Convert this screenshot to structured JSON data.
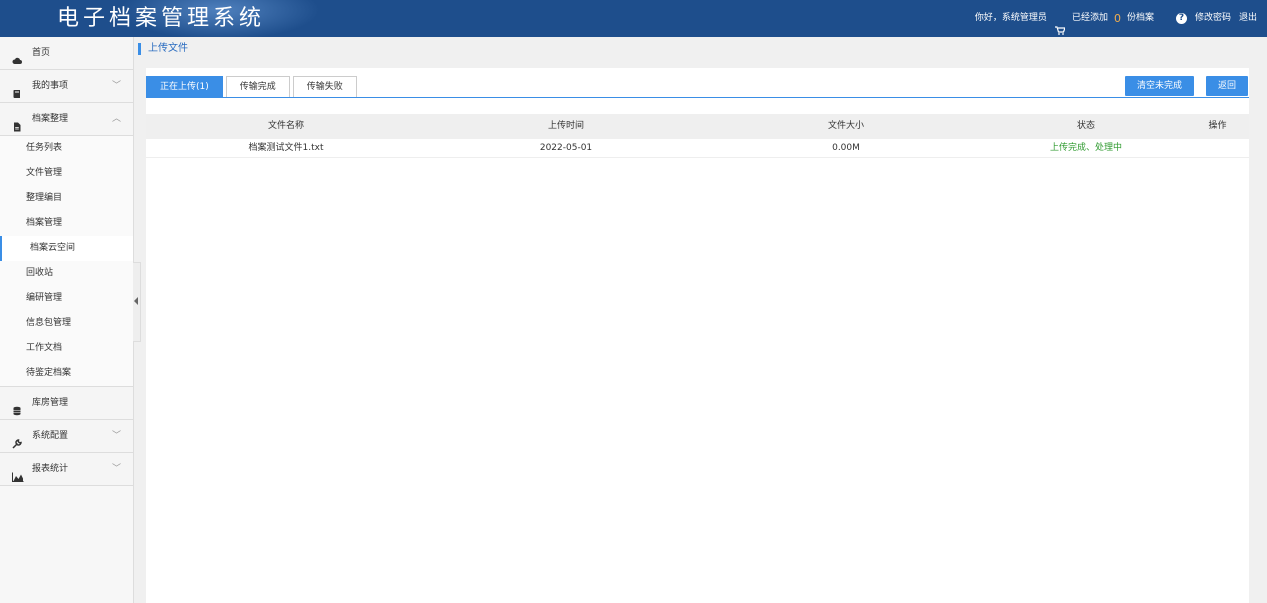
{
  "header": {
    "title": "电子档案管理系统",
    "greeting": "你好，系统管理员",
    "added_prefix": "已经添加",
    "added_count": "0",
    "added_suffix": "份档案",
    "change_password": "修改密码",
    "logout": "退出",
    "icons": {
      "cart": "cart-icon",
      "help": "help-icon"
    }
  },
  "sidebar": {
    "items": [
      {
        "label": "首页",
        "icon": "cloud-icon"
      },
      {
        "label": "我的事项",
        "icon": "book-icon"
      },
      {
        "label": "档案整理",
        "icon": "file-icon"
      },
      {
        "label": "库房管理",
        "icon": "database-icon"
      },
      {
        "label": "系统配置",
        "icon": "wrench-icon"
      },
      {
        "label": "报表统计",
        "icon": "area-chart-icon"
      }
    ],
    "sub_items": [
      "任务列表",
      "文件管理",
      "整理编目",
      "档案管理",
      "档案云空间",
      "回收站",
      "编研管理",
      "信息包管理",
      "工作文档",
      "待鉴定档案"
    ],
    "active_sub": "档案云空间"
  },
  "breadcrumb": {
    "title": "上传文件"
  },
  "tabs": [
    {
      "label": "正在上传(1)",
      "active": true
    },
    {
      "label": "传输完成",
      "active": false
    },
    {
      "label": "传输失败",
      "active": false
    }
  ],
  "buttons": {
    "clear_incomplete": "清空未完成",
    "back": "返回"
  },
  "table": {
    "columns": [
      "文件名称",
      "上传时间",
      "文件大小",
      "状态",
      "操作"
    ],
    "rows": [
      {
        "name": "档案测试文件1.txt",
        "time": "2022-05-01",
        "size": "0.00M",
        "status": "上传完成、处理中",
        "action": ""
      }
    ]
  },
  "colors": {
    "header_bg": "#1e4e8c",
    "accent": "#3a8ee6",
    "status_ok": "#2e9a2e",
    "count": "#f0ad4e"
  }
}
